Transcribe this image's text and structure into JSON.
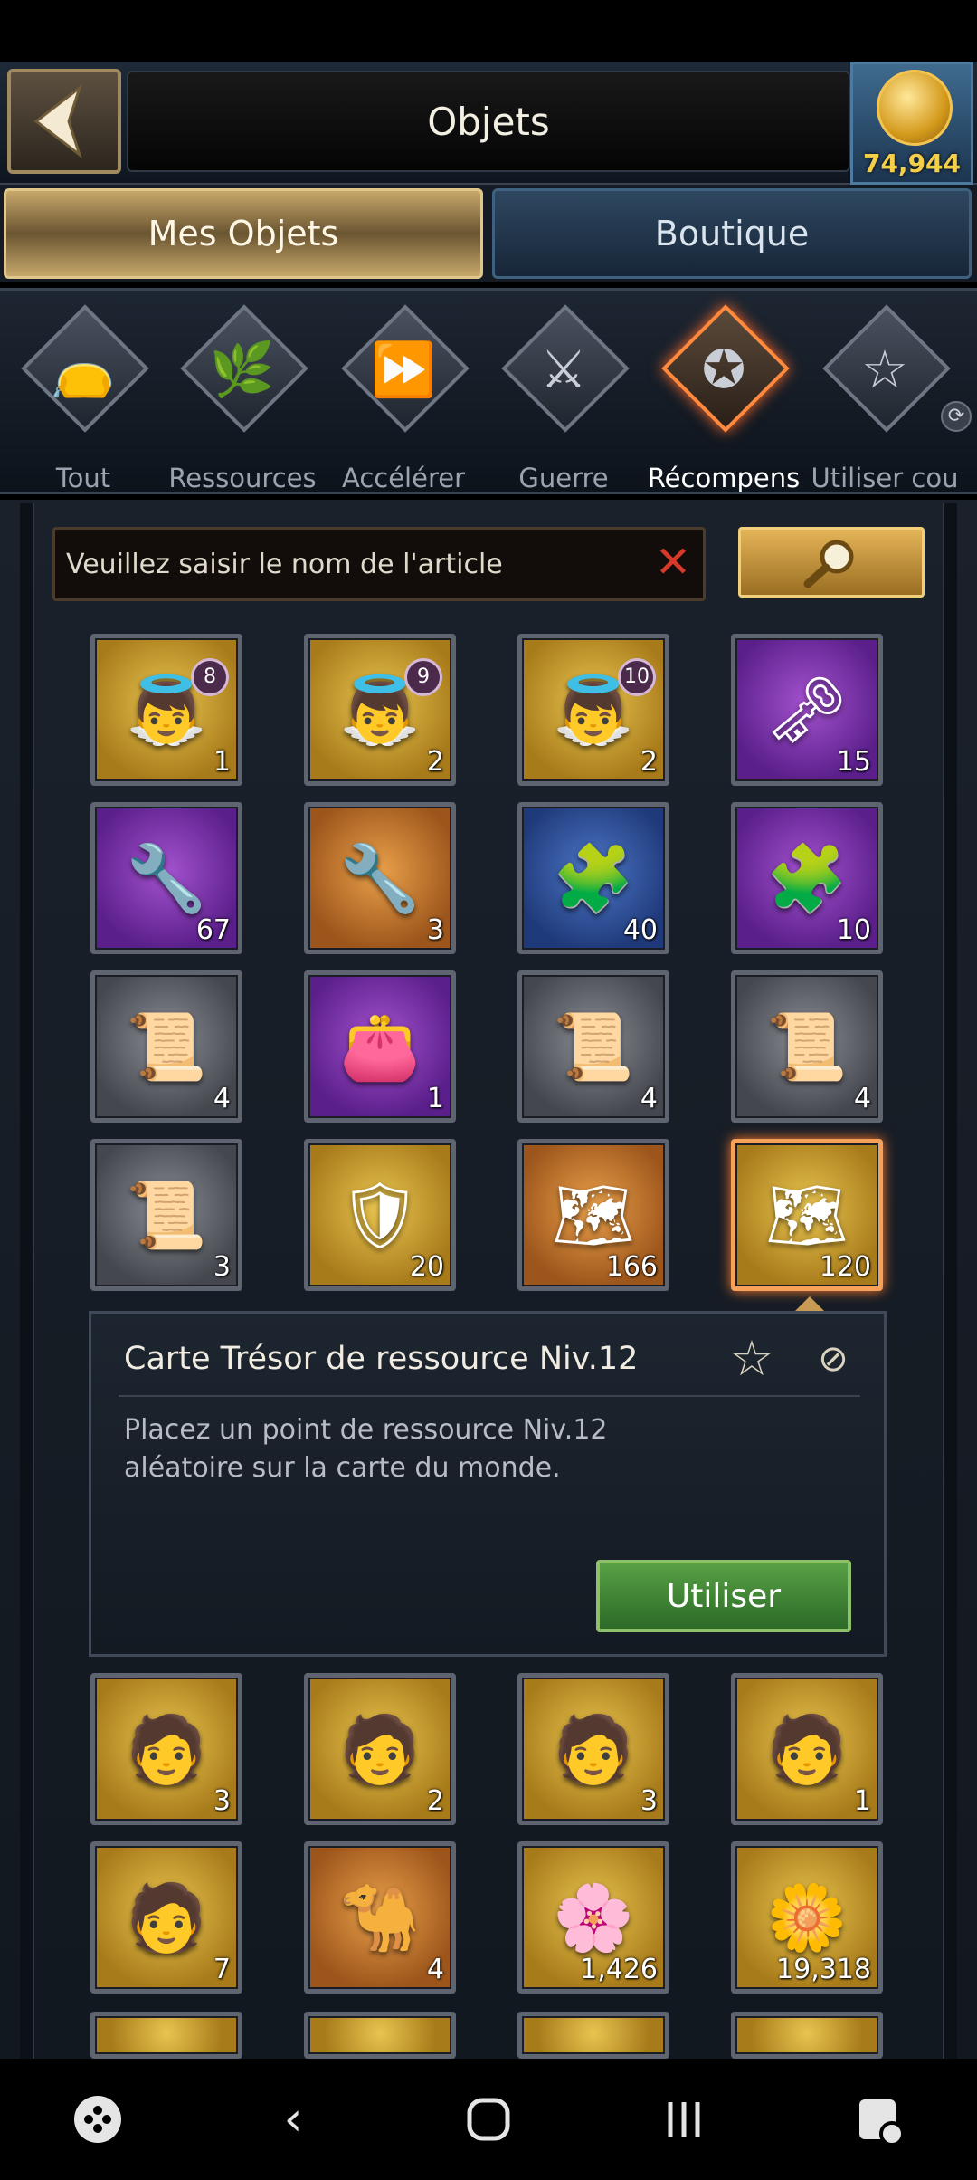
{
  "header": {
    "title": "Objets",
    "gold": "74,944"
  },
  "tabs": {
    "mine": "Mes Objets",
    "shop": "Boutique"
  },
  "categories": [
    {
      "label": "Tout",
      "icon": "bag-icon",
      "glyph": "👝"
    },
    {
      "label": "Ressources",
      "icon": "leaf-icon",
      "glyph": "🌿"
    },
    {
      "label": "Accélérer",
      "icon": "fast-forward-icon",
      "glyph": "⏩"
    },
    {
      "label": "Guerre",
      "icon": "crossed-swords-icon",
      "glyph": "⚔"
    },
    {
      "label": "Récompens",
      "icon": "star-badge-icon",
      "glyph": "✪"
    },
    {
      "label": "Utiliser cou",
      "icon": "star-outline-icon",
      "glyph": "☆"
    }
  ],
  "search": {
    "placeholder": "Veuillez saisir le nom de l'article"
  },
  "items": [
    {
      "qty": "1",
      "level": "8",
      "icon": "angel-statue-icon",
      "glyph": "👼",
      "bg": "gold"
    },
    {
      "qty": "2",
      "level": "9",
      "icon": "angel-statue-icon",
      "glyph": "👼",
      "bg": "gold"
    },
    {
      "qty": "2",
      "level": "10",
      "icon": "angel-statue-icon",
      "glyph": "👼",
      "bg": "gold"
    },
    {
      "qty": "15",
      "level": "",
      "icon": "key-icon",
      "glyph": "🗝",
      "bg": "purple"
    },
    {
      "qty": "67",
      "level": "",
      "icon": "chisel-icon",
      "glyph": "🔧",
      "bg": "purple"
    },
    {
      "qty": "3",
      "level": "",
      "icon": "chisel-icon",
      "glyph": "🔧",
      "bg": "orange"
    },
    {
      "qty": "40",
      "level": "",
      "icon": "puzzle-chisel-icon",
      "glyph": "🧩",
      "bg": "blue"
    },
    {
      "qty": "10",
      "level": "",
      "icon": "puzzle-chisel-icon",
      "glyph": "🧩",
      "bg": "purple"
    },
    {
      "qty": "4",
      "level": "",
      "icon": "scroll-map-icon",
      "glyph": "📜",
      "bg": "grey"
    },
    {
      "qty": "1",
      "level": "",
      "icon": "pouch-icon",
      "glyph": "👛",
      "bg": "purple"
    },
    {
      "qty": "4",
      "level": "",
      "icon": "scroll-map-icon",
      "glyph": "📜",
      "bg": "grey"
    },
    {
      "qty": "4",
      "level": "",
      "icon": "scroll-map-icon",
      "glyph": "📜",
      "bg": "grey"
    },
    {
      "qty": "3",
      "level": "",
      "icon": "scroll-icon",
      "glyph": "📜",
      "bg": "grey"
    },
    {
      "qty": "20",
      "level": "",
      "icon": "knight-puzzle-icon",
      "glyph": "🛡",
      "bg": "gold"
    },
    {
      "qty": "166",
      "level": "",
      "icon": "treasure-map-icon",
      "glyph": "🗺",
      "bg": "orange"
    },
    {
      "qty": "120",
      "level": "",
      "icon": "treasure-map-icon",
      "glyph": "🗺",
      "bg": "gold",
      "selected": true
    },
    {
      "qty": "3",
      "level": "",
      "icon": "portrait-icon",
      "glyph": "🧑",
      "bg": "gold"
    },
    {
      "qty": "2",
      "level": "",
      "icon": "portrait-icon",
      "glyph": "🧑",
      "bg": "gold"
    },
    {
      "qty": "3",
      "level": "",
      "icon": "portrait-icon",
      "glyph": "🧑",
      "bg": "gold"
    },
    {
      "qty": "1",
      "level": "",
      "icon": "portrait-icon",
      "glyph": "🧑",
      "bg": "gold"
    },
    {
      "qty": "7",
      "level": "",
      "icon": "portrait-icon",
      "glyph": "🧑",
      "bg": "gold"
    },
    {
      "qty": "4",
      "level": "",
      "icon": "camel-coin-icon",
      "glyph": "🐪",
      "bg": "orange"
    },
    {
      "qty": "1,426",
      "level": "",
      "icon": "blossom-branch-icon",
      "glyph": "🌸",
      "bg": "gold"
    },
    {
      "qty": "19,318",
      "level": "",
      "icon": "flower-icon",
      "glyph": "🌼",
      "bg": "gold"
    }
  ],
  "detail": {
    "title": "Carte Trésor de ressource Niv.12",
    "description": "Placez un point de ressource Niv.12 aléatoire sur la carte du monde.",
    "use_label": "Utiliser"
  }
}
